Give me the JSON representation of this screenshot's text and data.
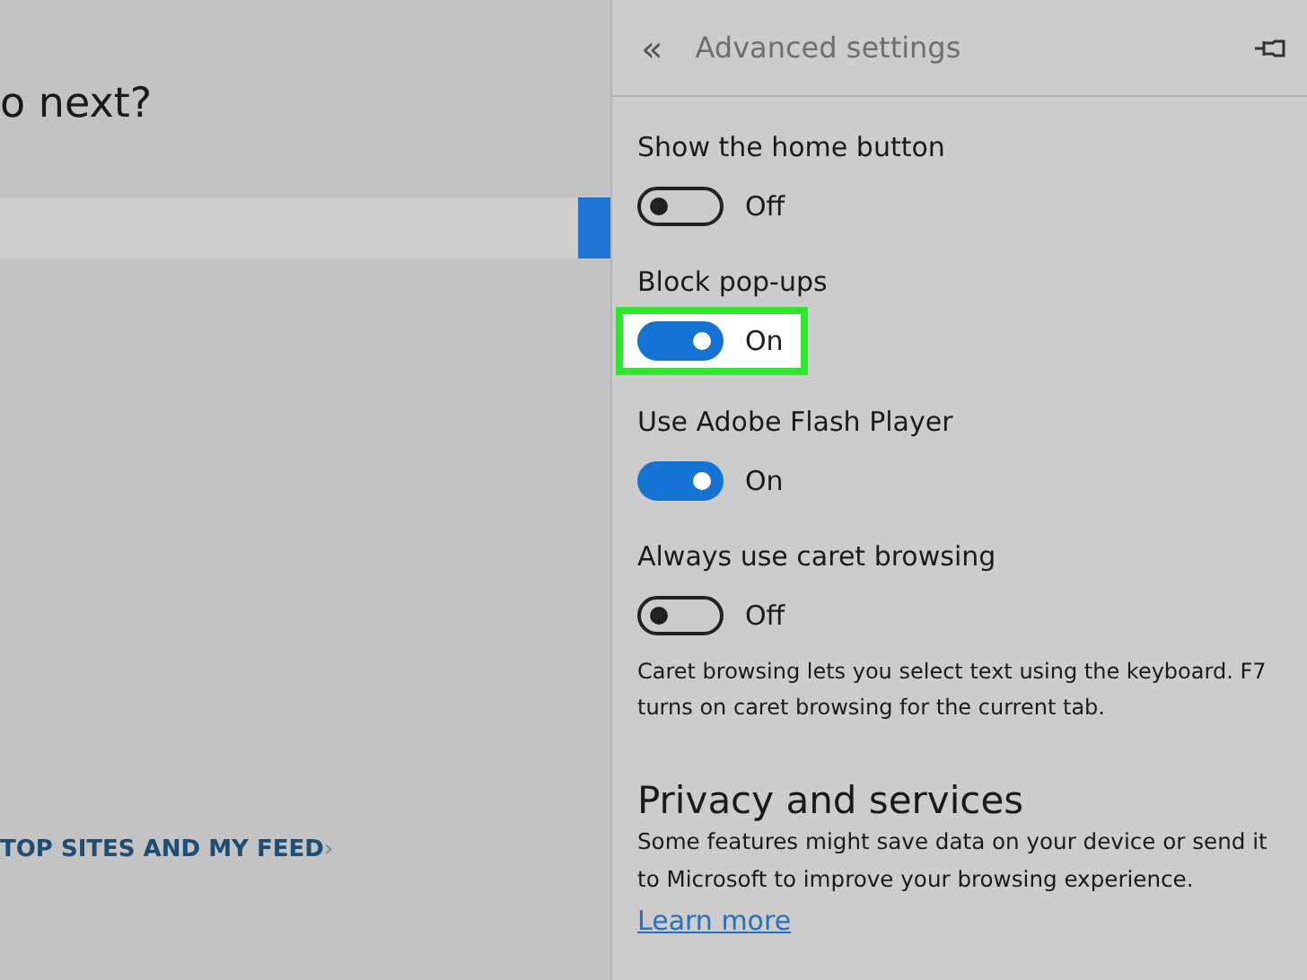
{
  "page": {
    "heading": "o next?",
    "feed_link": "TOP SITES AND MY FEED",
    "feed_chevron": "›"
  },
  "panel": {
    "back_glyph": "«",
    "title": "Advanced settings",
    "settings": [
      {
        "label": "Show the home button",
        "on": false,
        "state_text": "Off",
        "highlighted": false
      },
      {
        "label": "Block pop-ups",
        "on": true,
        "state_text": "On",
        "highlighted": true
      },
      {
        "label": "Use Adobe Flash Player",
        "on": true,
        "state_text": "On",
        "highlighted": false
      },
      {
        "label": "Always use caret browsing",
        "on": false,
        "state_text": "Off",
        "highlighted": false,
        "description": "Caret browsing lets you select text using the keyboard. F7 turns on caret browsing for the current tab."
      }
    ],
    "section": {
      "title": "Privacy and services",
      "text": "Some features might save data on your device or send it to Microsoft to improve your browsing experience.",
      "link": "Learn more"
    }
  }
}
